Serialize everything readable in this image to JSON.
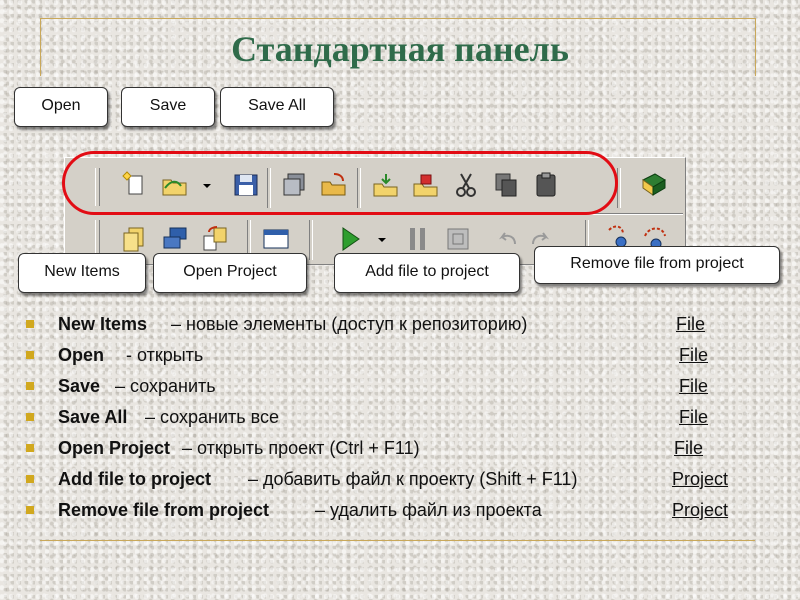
{
  "slide": {
    "title": "Стандартная панель"
  },
  "callouts": {
    "open": "Open",
    "save": "Save",
    "save_all": "Save All",
    "new_items": "New Items",
    "open_project": "Open Project",
    "add_file": "Add file to project",
    "remove_file": "Remove file from project"
  },
  "toolbar": {
    "highlight_color": "#e20c14",
    "row1_icons": [
      "new-items-icon",
      "open-icon",
      "dropdown-arrow-icon",
      "save-icon",
      "save-all-icon",
      "open-project-icon",
      "add-file-icon",
      "remove-file-icon",
      "cut-icon",
      "copy-icon",
      "paste-icon",
      "help-book-icon"
    ],
    "row2_icons": [
      "new-form-icon",
      "toggle-form-unit-icon",
      "view-unit-icon",
      "view-form-icon",
      "run-icon",
      "dropdown-arrow-icon",
      "pause-icon",
      "trace-into-icon",
      "undo-icon",
      "redo-icon",
      "step-into-icon",
      "step-over-icon"
    ]
  },
  "list": {
    "bullet_color": "#d1a81e",
    "items": [
      {
        "term": "New Items",
        "desc": "– новые элементы (доступ к репозиторию)",
        "menu": "File"
      },
      {
        "term": "Open",
        "desc": "-  открыть",
        "menu": "File"
      },
      {
        "term": "Save",
        "desc": "– сохранить",
        "menu": "File"
      },
      {
        "term": "Save All",
        "desc": "– сохранить все",
        "menu": "File"
      },
      {
        "term": "Open Project",
        "desc": "– открыть проект (Ctrl + F11)",
        "menu": "File"
      },
      {
        "term": "Add file to project",
        "desc": "– добавить файл к проекту (Shift + F11)",
        "menu": "Project"
      },
      {
        "term": "Remove file from project",
        "desc": "– удалить файл из проекта",
        "menu": "Project"
      }
    ]
  }
}
